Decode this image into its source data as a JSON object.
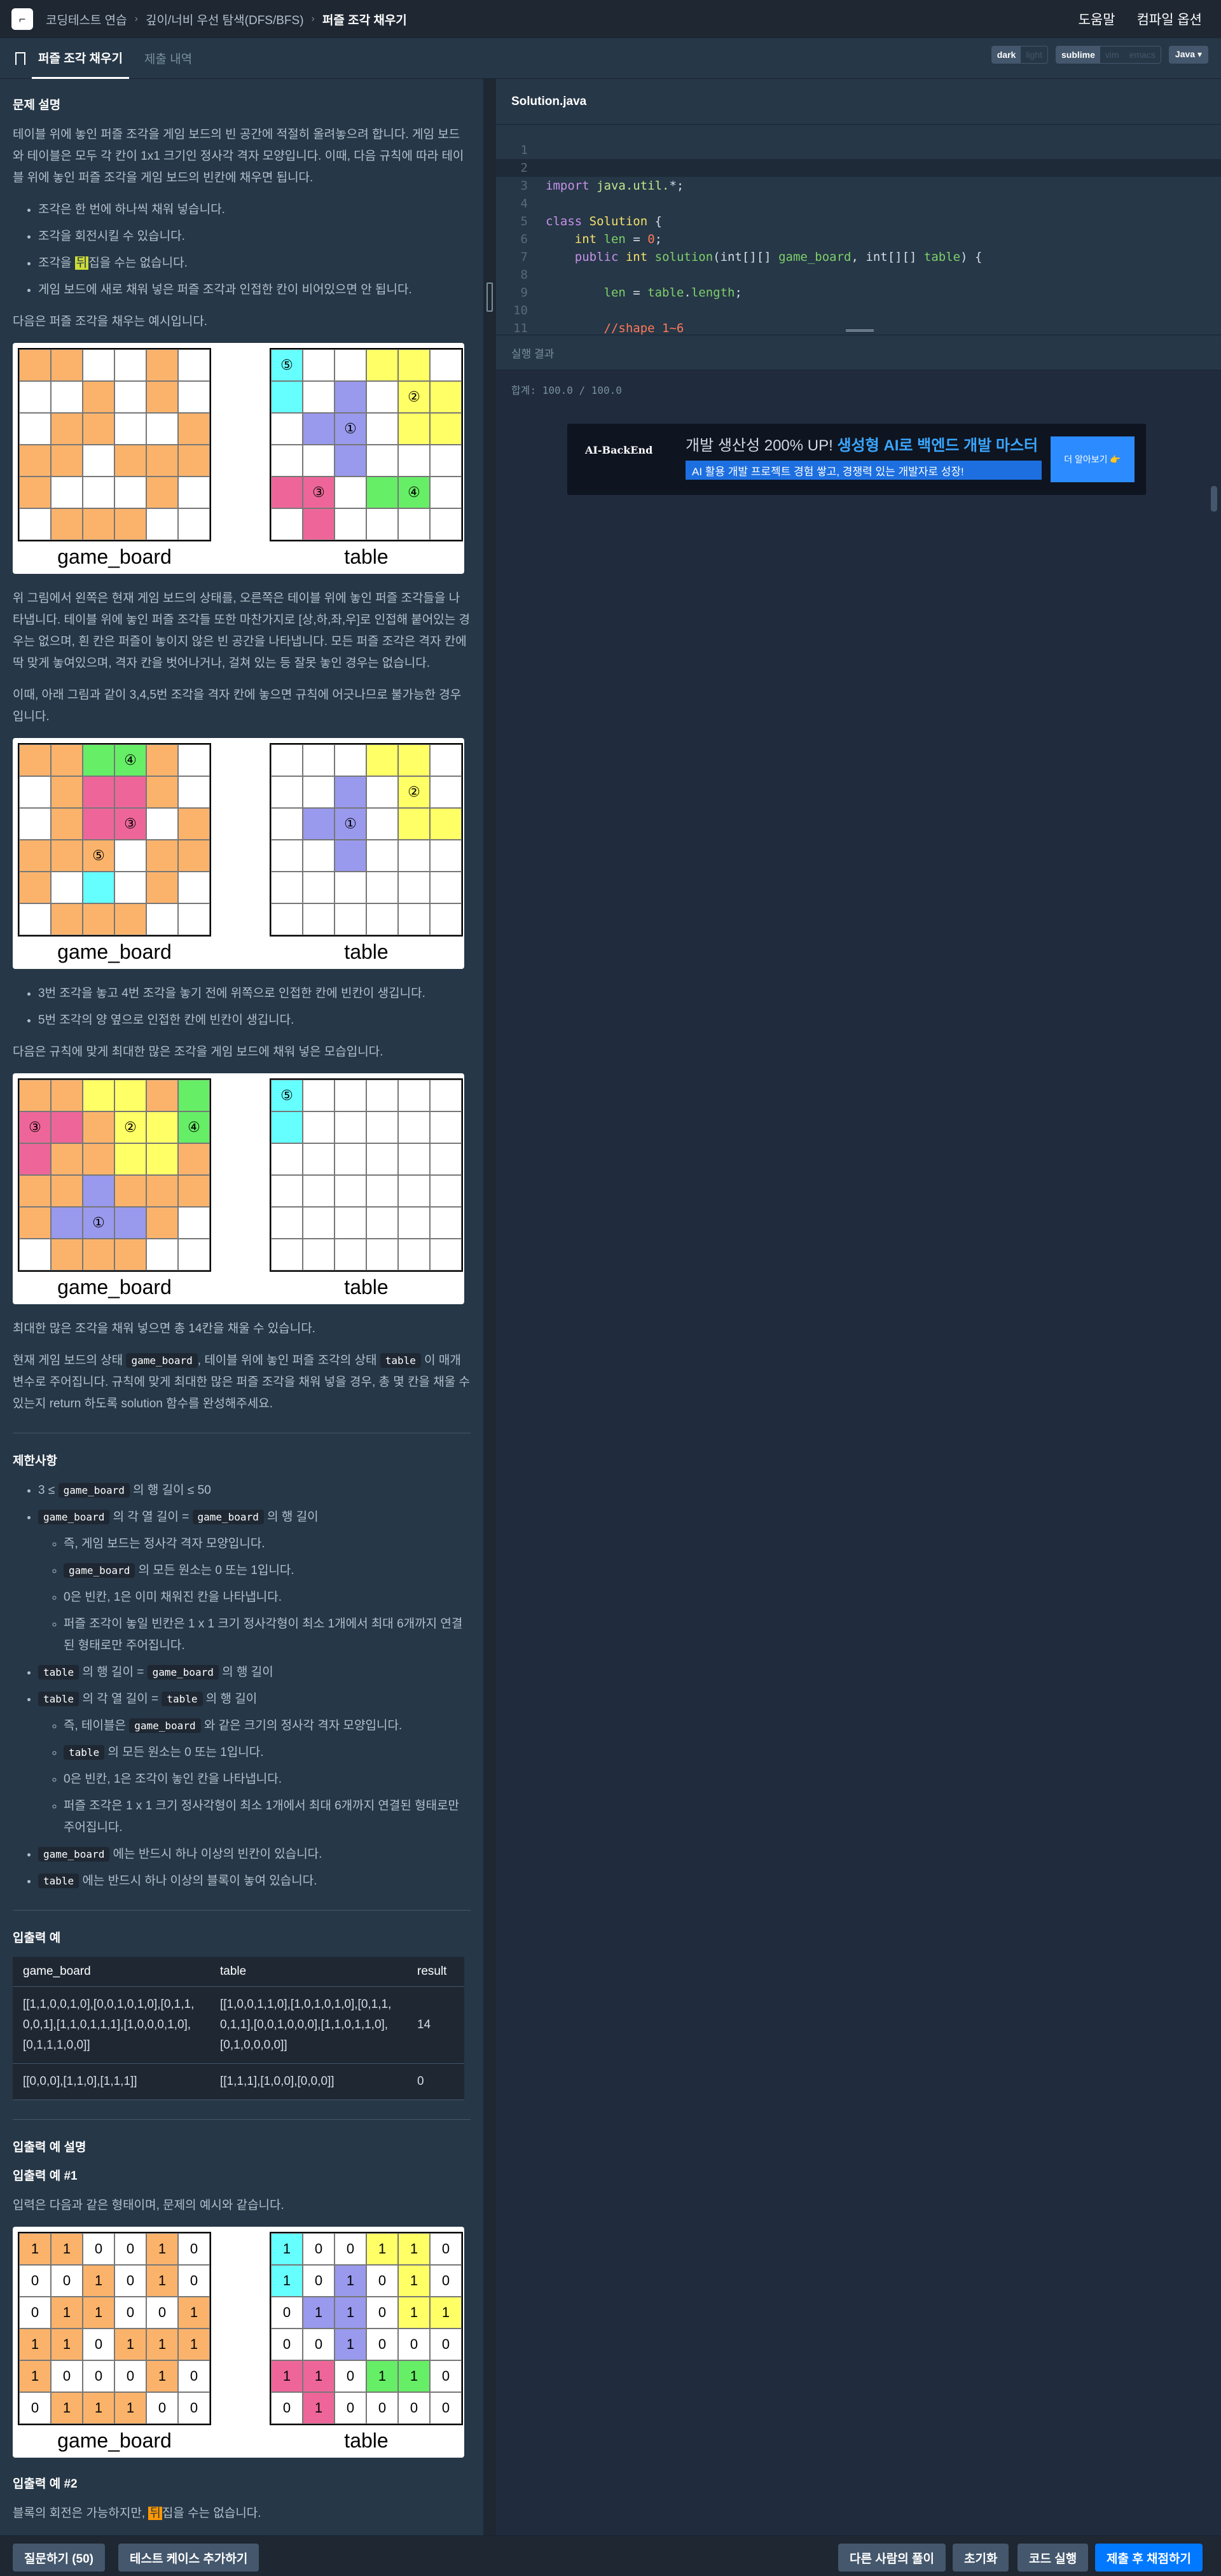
{
  "nav": {
    "crumbs": [
      "코딩테스트 연습",
      "깊이/너비 우선 탐색(DFS/BFS)",
      "퍼즐 조각 채우기"
    ],
    "help": "도움말",
    "compile_options": "컴파일 옵션"
  },
  "tabs": {
    "problem": "퍼즐 조각 채우기",
    "history": "제출 내역"
  },
  "toggles": {
    "dark": "dark",
    "light": "light",
    "sublime": "sublime",
    "vim": "vim",
    "emacs": "emacs",
    "language": "Java"
  },
  "problem": {
    "section_title": "문제 설명",
    "intro": "테이블 위에 놓인 퍼즐 조각을 게임 보드의 빈 공간에 적절히 올려놓으려 합니다. 게임 보드와 테이블은 모두 각 칸이 1x1 크기인 정사각 격자 모양입니다. 이때, 다음 규칙에 따라 테이블 위에 놓인 퍼즐 조각을 게임 보드의 빈칸에 채우면 됩니다.",
    "rules": [
      "조각은 한 번에 하나씩 채워 넣습니다.",
      "조각을 회전시킬 수 있습니다.",
      "조각을 ",
      "뒤",
      "집을 수는 없습니다.",
      "게임 보드에 새로 채워 넣은 퍼즐 조각과 인접한 칸이 비어있으면 안 됩니다."
    ],
    "example_intro": "다음은 퍼즐 조각을 채우는 예시입니다.",
    "p2": "위 그림에서 왼쪽은 현재 게임 보드의 상태를, 오른쪽은 테이블 위에 놓인 퍼즐 조각들을 나타냅니다. 테이블 위에 놓인 퍼즐 조각들 또한 마찬가지로 [상,하,좌,우]로 인접해 붙어있는 경우는 없으며, 흰 칸은 퍼즐이 놓이지 않은 빈 공간을 나타냅니다. 모든 퍼즐 조각은 격자 칸에 딱 맞게 놓여있으며, 격자 칸을 벗어나거나, 걸쳐 있는 등 잘못 놓인 경우는 없습니다.",
    "p3": "이때, 아래 그림과 같이 3,4,5번 조각을 격자 칸에 놓으면 규칙에 어긋나므로 불가능한 경우입니다.",
    "bad": [
      "3번 조각을 놓고 4번 조각을 놓기 전에 위쪽으로 인접한 칸에 빈칸이 생깁니다.",
      "5번 조각의 양 옆으로 인접한 칸에 빈칸이 생깁니다."
    ],
    "p4": "다음은 규칙에 맞게 최대한 많은 조각을 게임 보드에 채워 넣은 모습입니다.",
    "p5": "최대한 많은 조각을 채워 넣으면 총 14칸을 채울 수 있습니다.",
    "p6a": "현재 게임 보드의 상태 ",
    "p6b": ", 테이블 위에 놓인 퍼즐 조각의 상태 ",
    "p6c": " 이 매개변수로 주어집니다. 규칙에 맞게 최대한 많은 퍼즐 조각을 채워 넣을 경우, 총 몇 칸을 채울 수 있는지 return 하도록 solution 함수를 완성해주세요.",
    "game_board": "game_board",
    "table": "table"
  },
  "constraints": {
    "title": "제한사항",
    "c1a": "3 ≤ ",
    "c1b": " 의 행 길이 ≤ 50",
    "c2b": " 의 각 열 길이 = ",
    "c2d": " 의 행 길이",
    "c2s": [
      "즉, 게임 보드는 정사각 격자 모양입니다.",
      " 의 모든 원소는 0 또는 1입니다.",
      "0은 빈칸, 1은 이미 채워진 칸을 나타냅니다.",
      "퍼즐 조각이 놓일 빈칸은 1 x 1 크기 정사각형이 최소 1개에서 최대 6개까지 연결된 형태로만 주어집니다."
    ],
    "c3b": " 의 행 길이 = ",
    "c3d": " 의 행 길이",
    "c4b": " 의 각 열 길이 = ",
    "c4d": " 의 행 길이",
    "c4s": [
      "즉, 테이블은 ",
      " 와 같은 크기의 정사각 격자 모양입니다.",
      " 의 모든 원소는 0 또는 1입니다.",
      "0은 빈칸, 1은 조각이 놓인 칸을 나타냅니다.",
      "퍼즐 조각은 1 x 1 크기 정사각형이 최소 1개에서 최대 6개까지 연결된 형태로만 주어집니다."
    ],
    "c5": "에는 반드시 하나 이상의 빈칸이 있습니다.",
    "c6": "에는 반드시 하나 이상의 블록이 놓여 있습니다."
  },
  "io": {
    "title": "입출력 예",
    "headers": [
      "game_board",
      "table",
      "result"
    ],
    "rows": [
      [
        "[[1,1,0,0,1,0],[0,0,1,0,1,0],[0,1,1,0,0,1],[1,1,0,1,1,1],[1,0,0,0,1,0],[0,1,1,1,0,0]]",
        "[[1,0,0,1,1,0],[1,0,1,0,1,0],[0,1,1,0,1,1],[0,0,1,0,0,0],[1,1,0,1,1,0],[0,1,0,0,0,0]]",
        "14"
      ],
      [
        "[[0,0,0],[1,1,0],[1,1,1]]",
        "[[1,1,1],[1,0,0],[0,0,0]]",
        "0"
      ]
    ]
  },
  "explain": {
    "title": "입출력 예 설명",
    "ex1": "입출력 예 #1",
    "ex1_text": "입력은 다음과 같은 형태이며, 문제의 예시와 같습니다.",
    "ex2": "입출력 예 #2",
    "ex2a": "블록의 회전은 가능하지만, ",
    "ex2b": "뒤",
    "ex2c": "집을 수는 없습니다."
  },
  "editor": {
    "filename": "Solution.java",
    "results_label": "실행 결과",
    "result_text": "합계: 100.0 / 100.0"
  },
  "banner": {
    "brand": "AI-BackEnd",
    "line1a": "개발 생산성 200% UP! ",
    "line1b": "생성형 AI로 백엔드 개발 마스터",
    "line2": "AI 활용 개발 프로젝트 경험 쌓고, 경쟁력 있는 개발자로 성장!",
    "btn": "더 알아보기 👉"
  },
  "bottom": {
    "ask": "질문하기 (50)",
    "add_test": "테스트 케이스 추가하기",
    "others": "다른 사람의 풀이",
    "reset": "초기화",
    "run": "코드 실행",
    "submit": "제출 후 채점하기"
  },
  "colors": {
    "orange": "#fbb36b",
    "cyan": "#66ffff",
    "violet": "#9999ee",
    "yellow": "#ffff66",
    "pink": "#ee6699",
    "green": "#66ee66",
    "accent": "#0078ff"
  },
  "figures": {
    "fig1": {
      "left": [
        "OOWWOW",
        "WWOWOW",
        "WOOWWO",
        "OOWOOO",
        "OWWWOW",
        "WOOOWW"
      ],
      "right": [
        "CWWYYW",
        "CWVWYY",
        "WVVWYY",
        "WWVWWW",
        "PPWGGW",
        "WPWWWW"
      ],
      "left_nums": [],
      "right_nums": [
        [
          0,
          0,
          "⑤"
        ],
        [
          1,
          4,
          "②"
        ],
        [
          2,
          2,
          "①"
        ],
        [
          4,
          1,
          "③"
        ],
        [
          4,
          4,
          "④"
        ]
      ]
    },
    "fig2": {
      "left": [
        "OOGGOW",
        "WOPPOW",
        "WOPPWO",
        "OOOWOO",
        "OWCWOW",
        "WOOOWW"
      ],
      "right": [
        "WWWYYW",
        "WWVWYW",
        "WVVWYY",
        "WWVWWW",
        "WWWWWW",
        "WWWWWW"
      ],
      "left_nums": [
        [
          0,
          3,
          "④"
        ],
        [
          2,
          3,
          "③"
        ],
        [
          3,
          2,
          "⑤"
        ]
      ],
      "right_nums": [
        [
          1,
          4,
          "②"
        ],
        [
          2,
          2,
          "①"
        ]
      ]
    },
    "fig3": {
      "left": [
        "OOYYOG",
        "PPOYYG",
        "POOYYO",
        "OOVOOO",
        "OVVVOW",
        "WOOOWW"
      ],
      "right": [
        "CWWWWW",
        "CWWWWW",
        "WWWWWW",
        "WWWWWW",
        "WWWWWW",
        "WWWWWW"
      ],
      "left_nums": [
        [
          1,
          0,
          "③"
        ],
        [
          1,
          3,
          "②"
        ],
        [
          1,
          5,
          "④"
        ],
        [
          4,
          2,
          "①"
        ]
      ],
      "right_nums": [
        [
          0,
          0,
          "⑤"
        ]
      ]
    },
    "fig4": {
      "left": [
        "OOWWOW",
        "WWOWOW",
        "WOOWWO",
        "OOWOOO",
        "OWWWOW",
        "WOOOWW"
      ],
      "right": [
        "CWWYYW",
        "CWVWYW",
        "WVVWYY",
        "WWVWWW",
        "PPWGGW",
        "WPWWWW"
      ],
      "left_vals": [
        "110010",
        "001010",
        "011001",
        "110111",
        "100010",
        "011100"
      ],
      "right_vals": [
        "100110",
        "101010",
        "011011",
        "001000",
        "110110",
        "010000"
      ]
    }
  }
}
